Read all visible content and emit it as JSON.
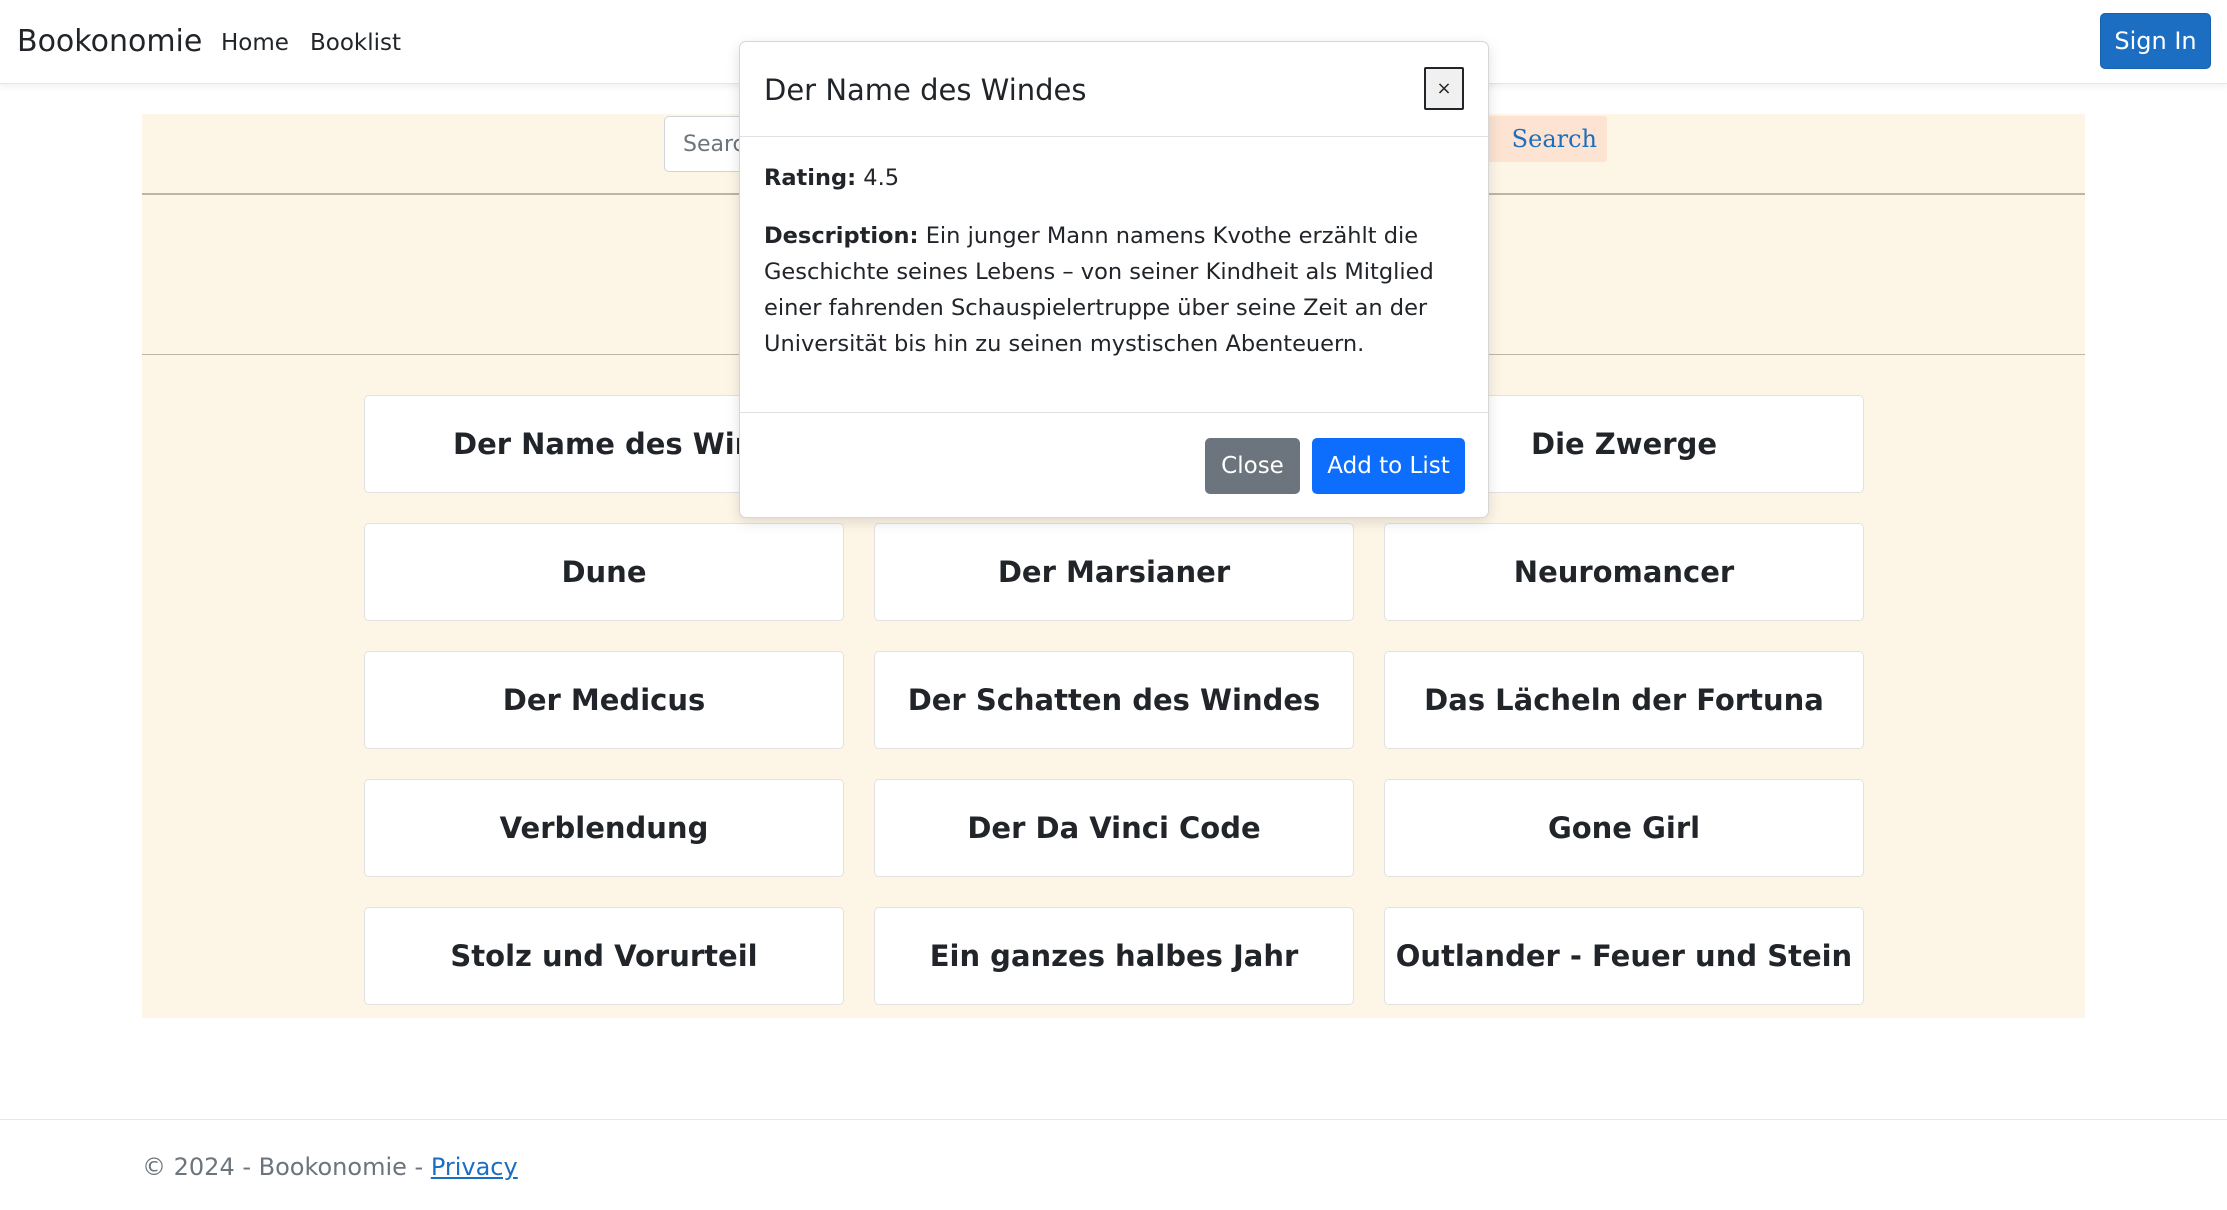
{
  "navbar": {
    "brand": "Bookonomie",
    "links": [
      {
        "label": "Home"
      },
      {
        "label": "Booklist"
      }
    ],
    "signin_label": "Sign In"
  },
  "search": {
    "placeholder": "Search",
    "button_label": "Search"
  },
  "books": [
    "Der Name des Windes",
    "",
    "Die Zwerge",
    "Dune",
    "Der Marsianer",
    "Neuromancer",
    "Der Medicus",
    "Der Schatten des Windes",
    "Das Lächeln der Fortuna",
    "Verblendung",
    "Der Da Vinci Code",
    "Gone Girl",
    "Stolz und Vorurteil",
    "Ein ganzes halbes Jahr",
    "Outlander - Feuer und Stein"
  ],
  "modal": {
    "title": "Der Name des Windes",
    "close_x": "×",
    "rating_label": "Rating:",
    "rating_value": "4.5",
    "description_label": "Description:",
    "description": "Ein junger Mann namens Kvothe erzählt die Geschichte seines Lebens – von seiner Kindheit als Mitglied einer fahrenden Schauspielertruppe über seine Zeit an der Universität bis hin zu seinen mystischen Abenteuern.",
    "close_label": "Close",
    "add_label": "Add to List"
  },
  "footer": {
    "text": "© 2024 - Bookonomie - ",
    "privacy_label": "Privacy"
  },
  "colors": {
    "primary": "#1b6ec2",
    "modal_primary": "#0d6efd",
    "secondary": "#6c757d",
    "page_panel": "#fdf5e6"
  }
}
